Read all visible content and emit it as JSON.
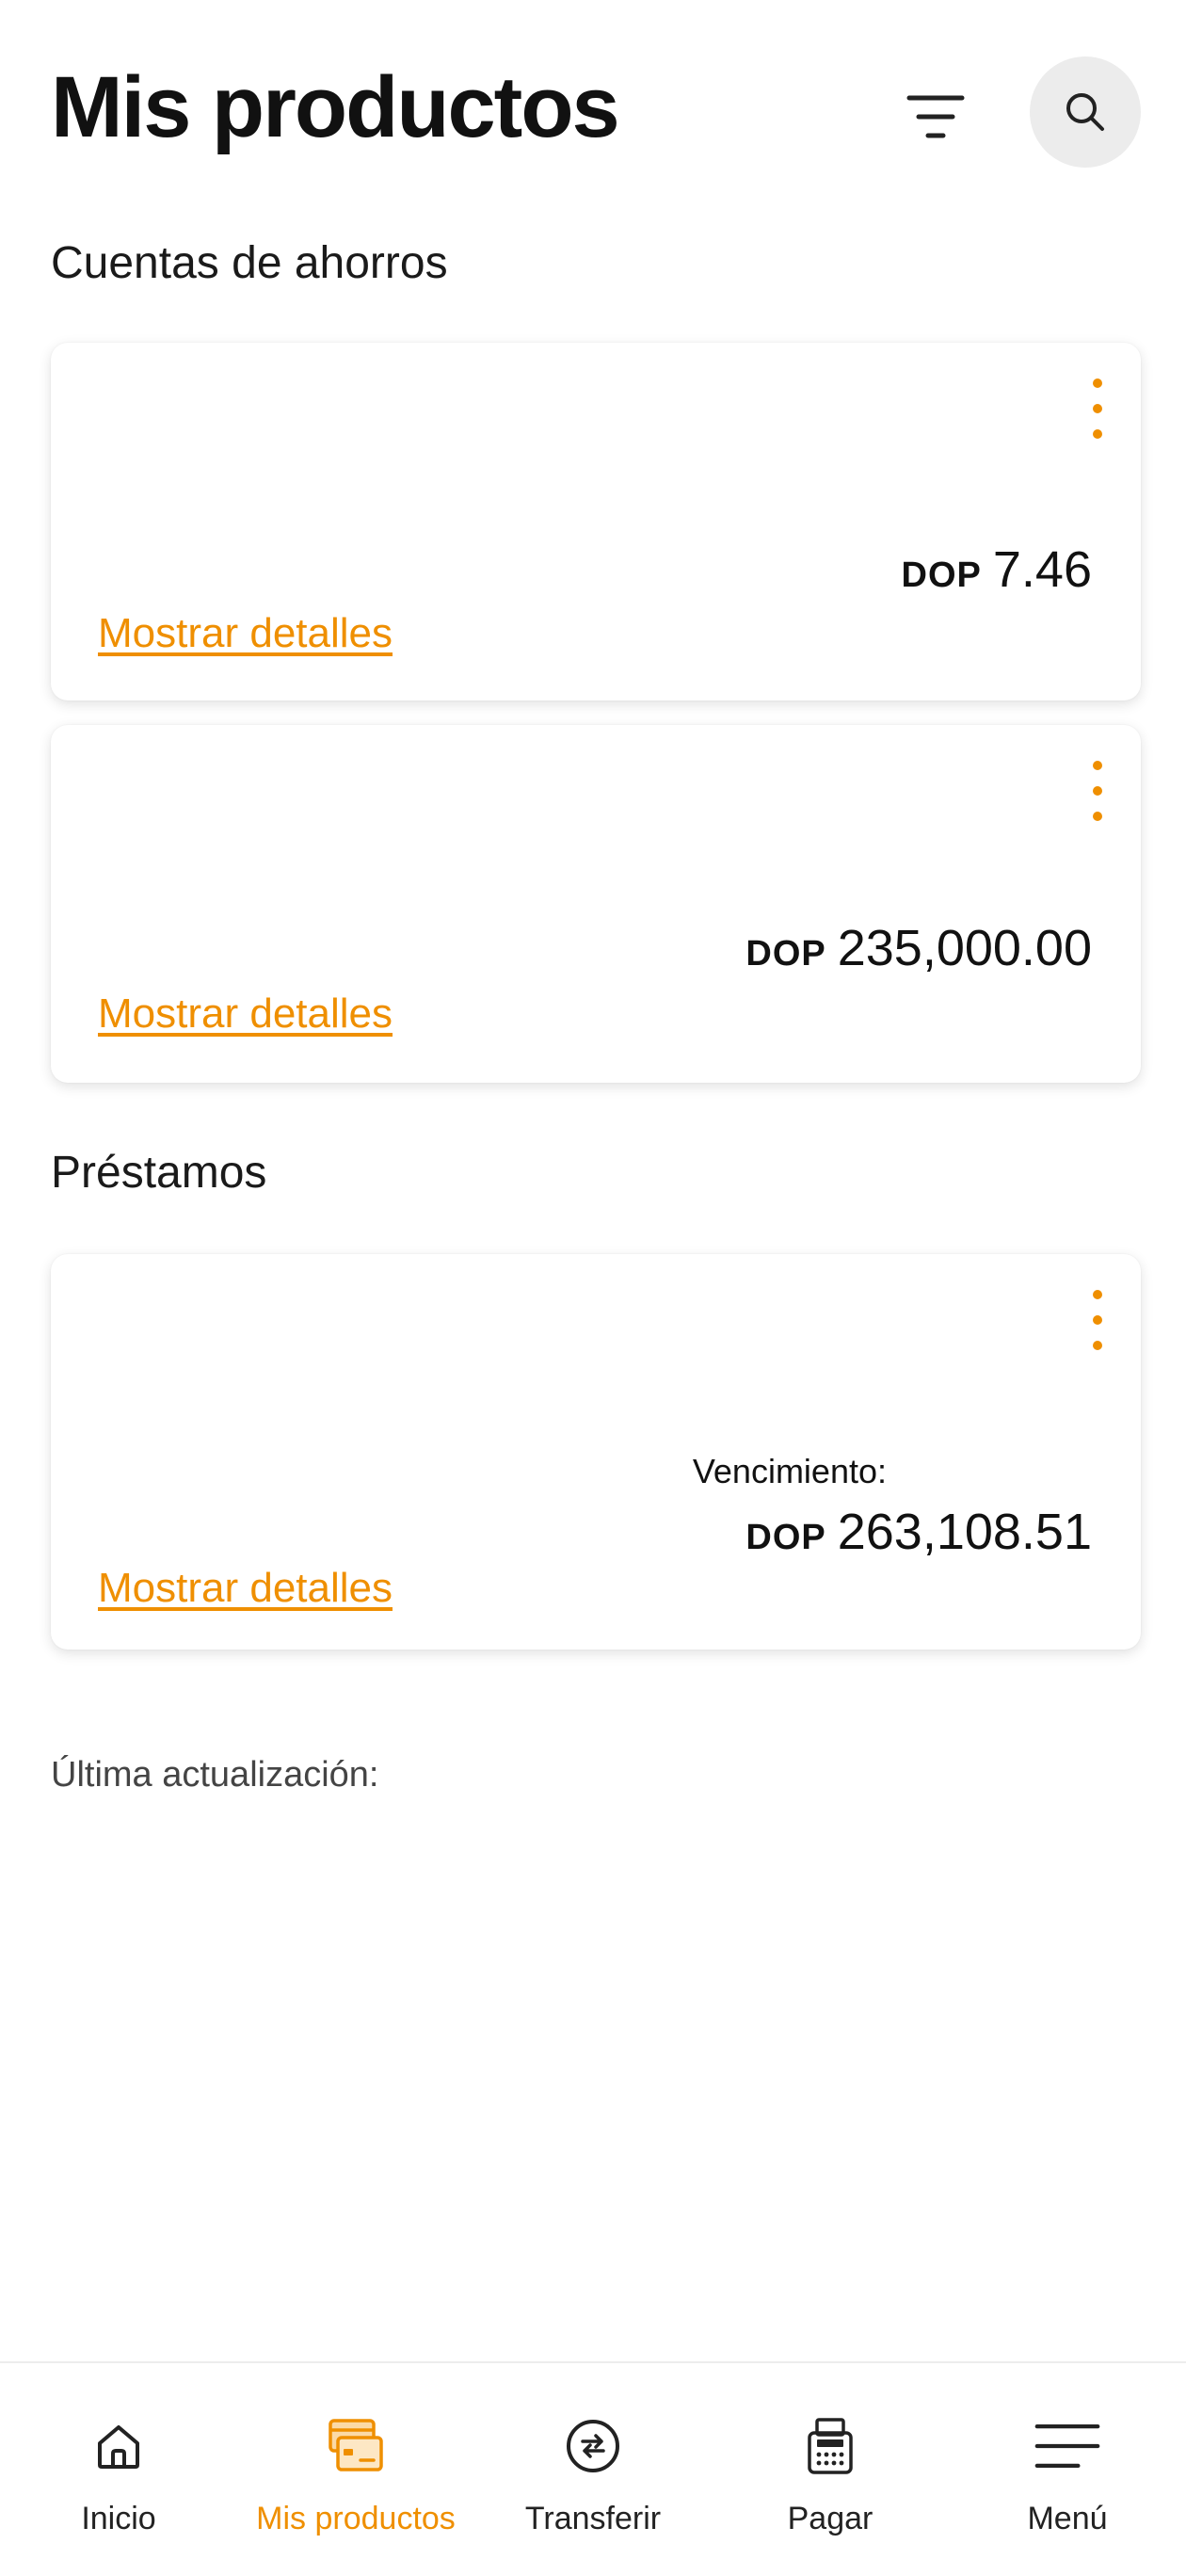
{
  "header": {
    "title": "Mis productos",
    "filter_icon": "filter-icon",
    "search_icon": "search-icon"
  },
  "savings": {
    "section_title": "Cuentas de ahorros",
    "accounts": [
      {
        "currency": "DOP",
        "amount": "7.46",
        "details_label": "Mostrar detalles"
      },
      {
        "currency": "DOP",
        "amount": "235,000.00",
        "details_label": "Mostrar detalles"
      }
    ]
  },
  "loans": {
    "section_title": "Préstamos",
    "items": [
      {
        "due_label": "Vencimiento:",
        "currency": "DOP",
        "amount": "263,108.51",
        "details_label": "Mostrar detalles"
      }
    ]
  },
  "footer": {
    "last_update_label": "Última actualización:"
  },
  "nav": {
    "items": [
      {
        "label": "Inicio",
        "icon": "home-icon",
        "active": false
      },
      {
        "label": "Mis productos",
        "icon": "cards-icon",
        "active": true
      },
      {
        "label": "Transferir",
        "icon": "transfer-icon",
        "active": false
      },
      {
        "label": "Pagar",
        "icon": "pay-terminal-icon",
        "active": false
      },
      {
        "label": "Menú",
        "icon": "menu-icon",
        "active": false
      }
    ]
  },
  "colors": {
    "accent": "#ef8f00",
    "text": "#111111",
    "search_bg": "#ececec"
  }
}
